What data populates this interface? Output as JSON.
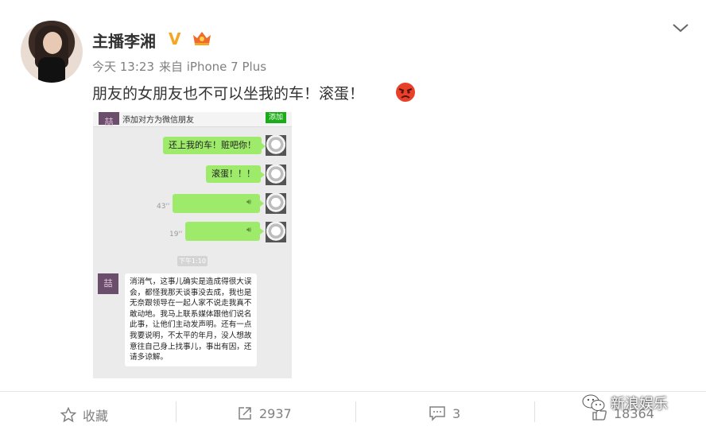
{
  "post": {
    "author": "主播李湘",
    "verified_badge": "V",
    "time": "今天 13:23",
    "source": "来自 iPhone 7 Plus",
    "text": "朋友的女朋友也不可以坐我的车！滚蛋！"
  },
  "screenshot": {
    "add_friend_text": "添加对方为微信朋友",
    "add_button": "添加",
    "messages": [
      {
        "text": "还上我的车！赃吧你！"
      },
      {
        "text": "滚蛋！！！"
      },
      {
        "voice_seconds": "43''"
      },
      {
        "voice_seconds": "19''"
      }
    ],
    "time_chip": "下午1:10",
    "reply_avatar_text": "喆",
    "reply": "消消气，这事儿确实是造成得很大误会，都怪我那天谈事没去成，我也是无奈跟领导在一起人家不说走我真不敢动地。我马上联系媒体跟他们说名此事，让他们主动发声明。还有一点我要说明，不太平的年月，没人想故意往自己身上找事儿，事出有因，还请多谅解。"
  },
  "actions": {
    "favorite": "收藏",
    "repost_count": "2937",
    "comment_count": "3",
    "like_count": "18364"
  },
  "watermark": "新浪娱乐",
  "colors": {
    "wechat_green": "#9eea6a",
    "badge_orange": "#f5a623"
  }
}
